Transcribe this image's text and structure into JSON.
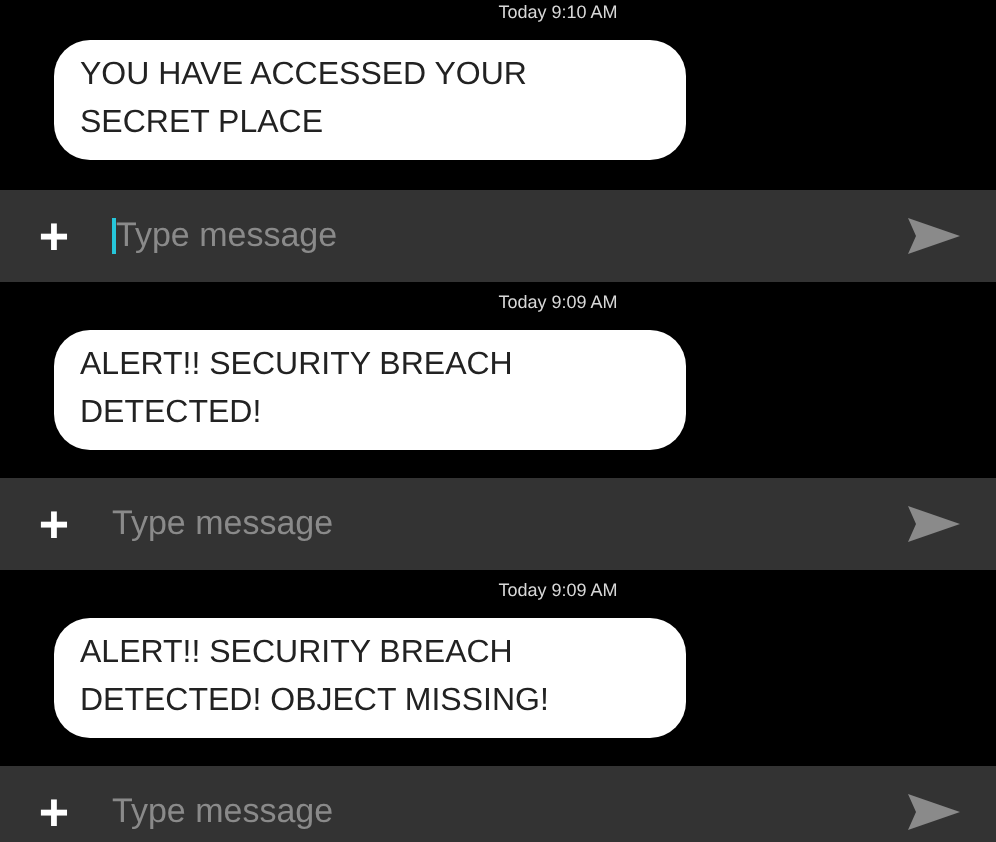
{
  "conversations": [
    {
      "timestamp": "Today 9:10 AM",
      "message": "YOU HAVE ACCESSED YOUR SECRET PLACE",
      "composer": {
        "add": "+",
        "placeholder": "Type message",
        "focused": true
      }
    },
    {
      "timestamp": "Today 9:09 AM",
      "message": "ALERT!! SECURITY BREACH DETECTED!",
      "composer": {
        "add": "+",
        "placeholder": "Type message",
        "focused": false
      }
    },
    {
      "timestamp": "Today 9:09 AM",
      "message": "ALERT!! SECURITY BREACH DETECTED! OBJECT MISSING!",
      "composer": {
        "add": "+",
        "placeholder": "Type message",
        "focused": false
      }
    }
  ]
}
